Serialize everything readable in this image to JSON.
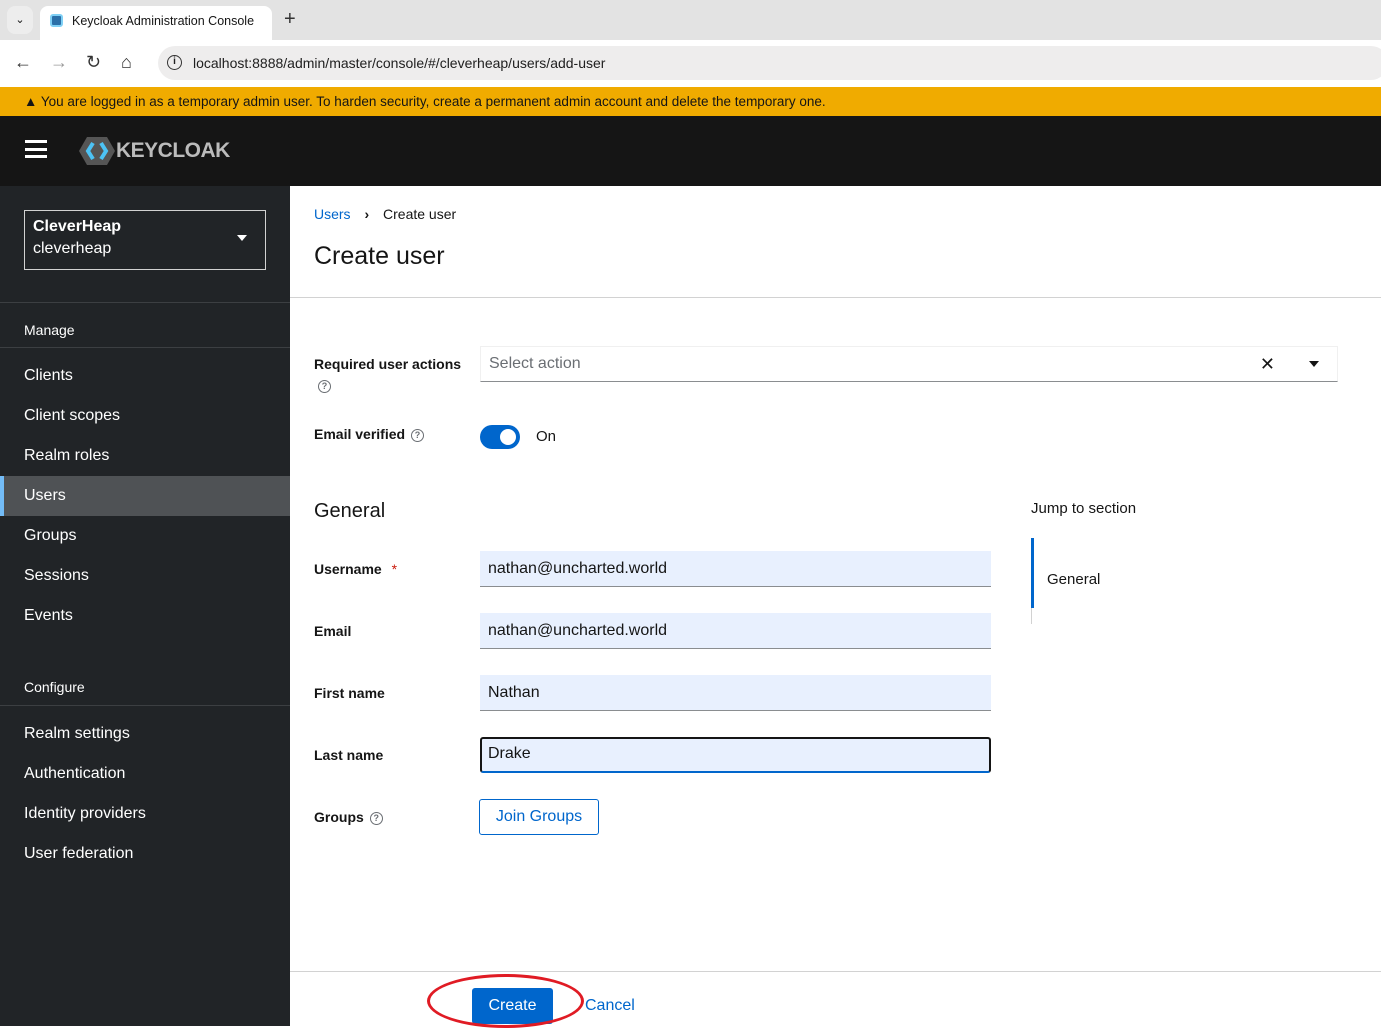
{
  "browser": {
    "tab_title": "Keycloak Administration Console",
    "url": "localhost:8888/admin/master/console/#/cleverheap/users/add-user"
  },
  "banner": {
    "text": "You are logged in as a temporary admin user. To harden security, create a permanent admin account and delete the temporary one."
  },
  "header": {
    "logo_text": "KEYCLOAK"
  },
  "sidebar": {
    "realm_name": "CleverHeap",
    "realm_id": "cleverheap",
    "manage_heading": "Manage",
    "manage_items": [
      "Clients",
      "Client scopes",
      "Realm roles",
      "Users",
      "Groups",
      "Sessions",
      "Events"
    ],
    "configure_heading": "Configure",
    "configure_items": [
      "Realm settings",
      "Authentication",
      "Identity providers",
      "User federation"
    ],
    "active": "Users"
  },
  "breadcrumb": {
    "parent": "Users",
    "current": "Create user"
  },
  "page": {
    "title": "Create user"
  },
  "form": {
    "required_actions_label": "Required user actions",
    "required_actions_placeholder": "Select action",
    "email_verified_label": "Email verified",
    "email_verified_state": "On",
    "email_verified": true,
    "section_title": "General",
    "username_label": "Username",
    "required_mark": "*",
    "username": "nathan@uncharted.world",
    "email_label": "Email",
    "email": "nathan@uncharted.world",
    "first_name_label": "First name",
    "first_name": "Nathan",
    "last_name_label": "Last name",
    "last_name": "Drake",
    "groups_label": "Groups",
    "join_groups": "Join Groups"
  },
  "jump": {
    "title": "Jump to section",
    "items": [
      "General"
    ]
  },
  "footer": {
    "create": "Create",
    "cancel": "Cancel"
  }
}
